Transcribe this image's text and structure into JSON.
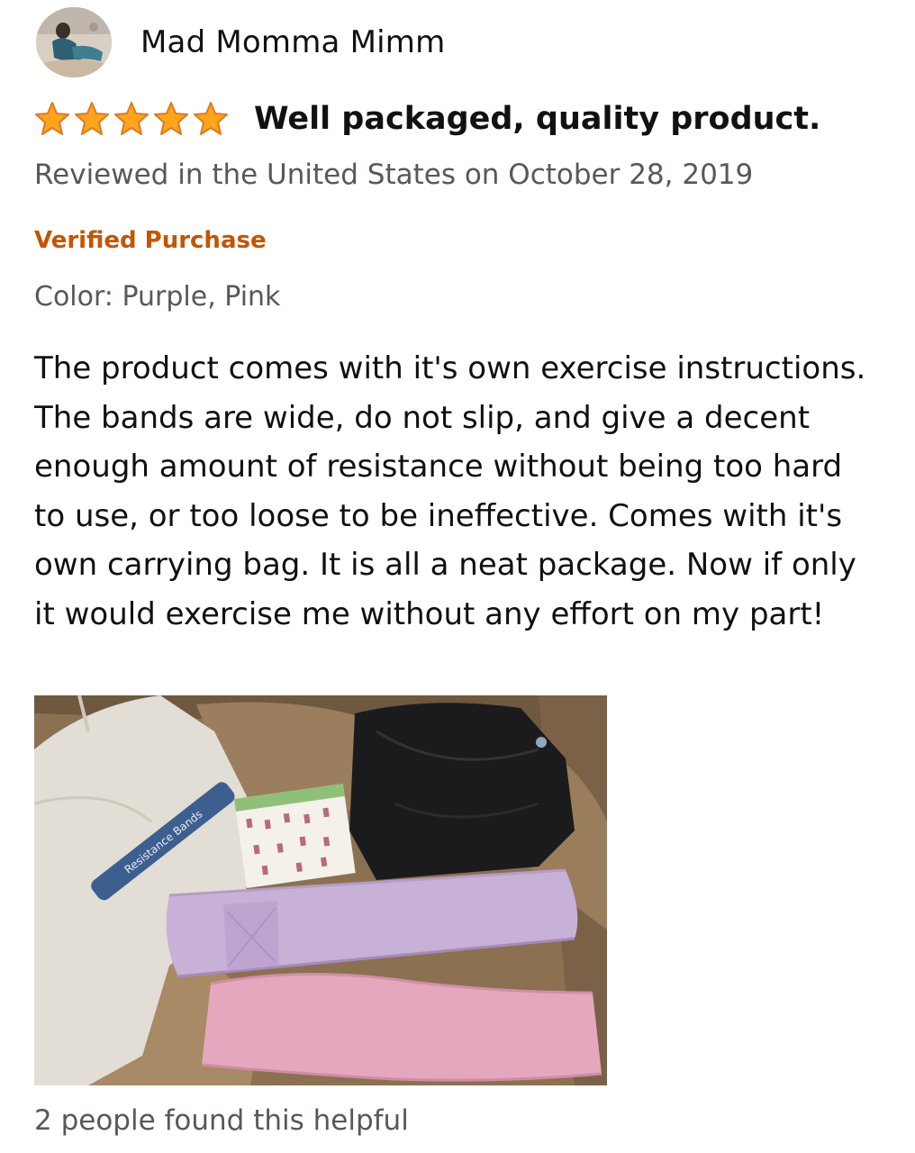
{
  "reviewer": {
    "name": "Mad Momma Mimm",
    "avatar_icon": "user-avatar-photo"
  },
  "review": {
    "rating": 5,
    "rating_max": 5,
    "star_color": "#ffa41c",
    "star_outline_color": "#de7921",
    "title": "Well packaged, quality product.",
    "date_line": "Reviewed in the United States on October 28, 2019",
    "verified_label": "Verified Purchase",
    "verified_color": "#c45500",
    "variant": "Color: Purple, Pink",
    "body": "The product comes with it's own exercise instructions. The bands are wide, do not slip, and give a decent enough amount of resistance without being too hard to use, or too loose to be ineffective. Comes with it's own carrying bag. It is all a neat package. Now if only it would exercise me without any effort on my part!",
    "image_bag_label": "Resistance Bands",
    "helpful_text": "2 people found this helpful"
  }
}
